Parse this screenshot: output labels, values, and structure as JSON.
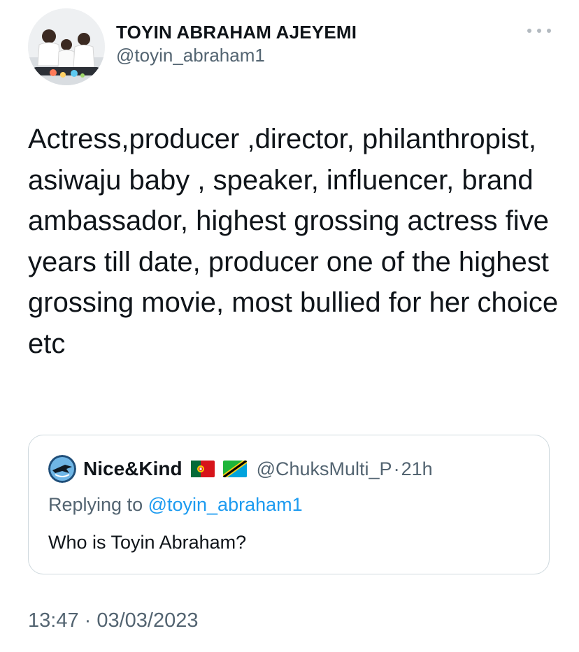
{
  "author": {
    "display_name": "TOYIN ABRAHAM AJEYEMI",
    "handle": "@toyin_abraham1",
    "more_icon": "more-horizontal-icon"
  },
  "tweet": {
    "text": "Actress,producer ,director, philanthropist, asiwaju baby , speaker, influencer, brand ambassador, highest grossing actress five years till date, producer one of the highest grossing movie, most bullied for her choice etc",
    "timestamp": "13:47 · 03/03/2023"
  },
  "quoted_tweet": {
    "display_name": "Nice&Kind",
    "flags": [
      "flag-portugal",
      "flag-tanzania"
    ],
    "handle": "@ChuksMulti_P",
    "separator": "·",
    "age": "21h",
    "replying_prefix": "Replying to ",
    "replying_to": "@toyin_abraham1",
    "text": "Who is Toyin Abraham?"
  },
  "colors": {
    "text_primary": "#0f1419",
    "text_secondary": "#536471",
    "link": "#1d9bf0",
    "border": "#cfd9de"
  }
}
